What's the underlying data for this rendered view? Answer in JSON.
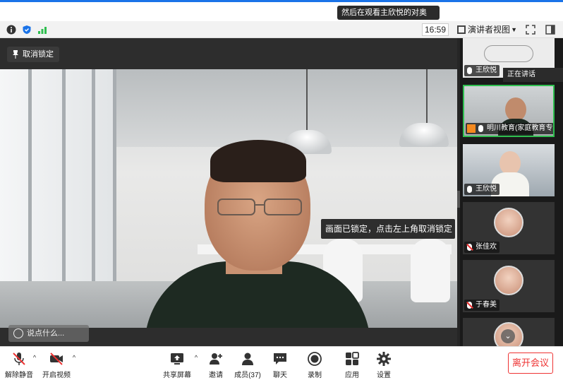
{
  "notification": {
    "text": "然后在观看主欣悦的对奥"
  },
  "toolbar": {
    "time": "16:59",
    "view_label": "演讲者视图"
  },
  "main": {
    "pin_label": "取消锁定",
    "tooltip": "画面已锁定，点击左上角取消锁定",
    "chat_placeholder": "说点什么..."
  },
  "side": {
    "share_banner": "正在讲话",
    "tiles": [
      {
        "label": "王欣悦"
      },
      {
        "label": "明川教育(家庭教育专家)"
      },
      {
        "label": "王欣悦"
      },
      {
        "label": "张佳欢"
      },
      {
        "label": "于春美"
      }
    ]
  },
  "bottombar": {
    "mute_label": "解除静音",
    "video_label": "开启视频",
    "share_label": "共享屏幕",
    "invite_label": "邀请",
    "members_label": "成员(37)",
    "chat_label": "聊天",
    "record_label": "录制",
    "apps_label": "应用",
    "settings_label": "设置",
    "leave_label": "离开会议"
  },
  "colors": {
    "accent": "#1a73e8",
    "leave": "#e33333",
    "active_border": "#2fbf4f"
  }
}
